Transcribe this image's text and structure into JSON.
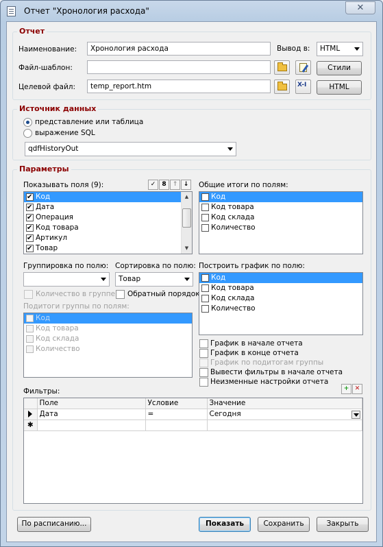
{
  "window": {
    "title": "Отчет \"Хронология расхода\"",
    "close_glyph": "✕"
  },
  "report": {
    "group_title": "Отчет",
    "name_label": "Наименование:",
    "name_value": "Хронология расхода",
    "output_label": "Вывод в:",
    "output_value": "HTML",
    "template_label": "Файл-шаблон:",
    "template_value": "",
    "target_label": "Целевой файл:",
    "target_value": "temp_report.htm",
    "styles_button": "Стили",
    "html_button": "HTML",
    "xsl_icon_text": "X-I"
  },
  "datasource": {
    "group_title": "Источник данных",
    "option_view": "представление или таблица",
    "option_sql": "выражение SQL",
    "selected_option": "view",
    "source_value": "qdfHistoryOut"
  },
  "params": {
    "group_title": "Параметры",
    "show_fields_label": "Показывать поля (9):",
    "show_fields": [
      {
        "label": "Код",
        "checked": true,
        "selected": true
      },
      {
        "label": "Дата",
        "checked": true,
        "selected": false
      },
      {
        "label": "Операция",
        "checked": true,
        "selected": false
      },
      {
        "label": "Код товара",
        "checked": true,
        "selected": false
      },
      {
        "label": "Артикул",
        "checked": true,
        "selected": false
      },
      {
        "label": "Товар",
        "checked": true,
        "selected": false
      }
    ],
    "totals_label": "Общие итоги по полям:",
    "totals": [
      "Код",
      "Код товара",
      "Код склада",
      "Количество"
    ],
    "group_by_label": "Группировка по полю:",
    "group_by_value": "",
    "sort_by_label": "Сортировка по полю:",
    "sort_by_value": "Товар",
    "count_in_group": "Количество в группе",
    "reverse_order": "Обратный порядок",
    "subtotals_label": "Подитоги группы по полям:",
    "subtotals": [
      "Код",
      "Код товара",
      "Код склада",
      "Количество"
    ],
    "chart_label": "Построить график по полю:",
    "chart_fields": [
      "Код",
      "Код товара",
      "Код склада",
      "Количество"
    ],
    "chart_options": [
      {
        "label": "График в начале отчета",
        "enabled": true
      },
      {
        "label": "График в конце отчета",
        "enabled": true
      },
      {
        "label": "График по подитогам группы",
        "enabled": false
      },
      {
        "label": "Вывести фильтры в начале отчета",
        "enabled": true
      },
      {
        "label": "Неизменные настройки отчета",
        "enabled": true
      }
    ],
    "filters_label": "Фильтры:",
    "filters_columns": [
      "Поле",
      "Условие",
      "Значение"
    ],
    "filters_rows": [
      {
        "field": "Дата",
        "condition": "=",
        "value": "Сегодня"
      }
    ],
    "new_row_marker": "✱",
    "add_filter_glyph": "+",
    "remove_filter_glyph": "✕"
  },
  "footer": {
    "schedule_button": "По расписанию...",
    "show_button": "Показать",
    "save_button": "Сохранить",
    "close_button": "Закрыть"
  },
  "colors": {
    "group_title": "#8b0000",
    "selection": "#3399ff"
  }
}
